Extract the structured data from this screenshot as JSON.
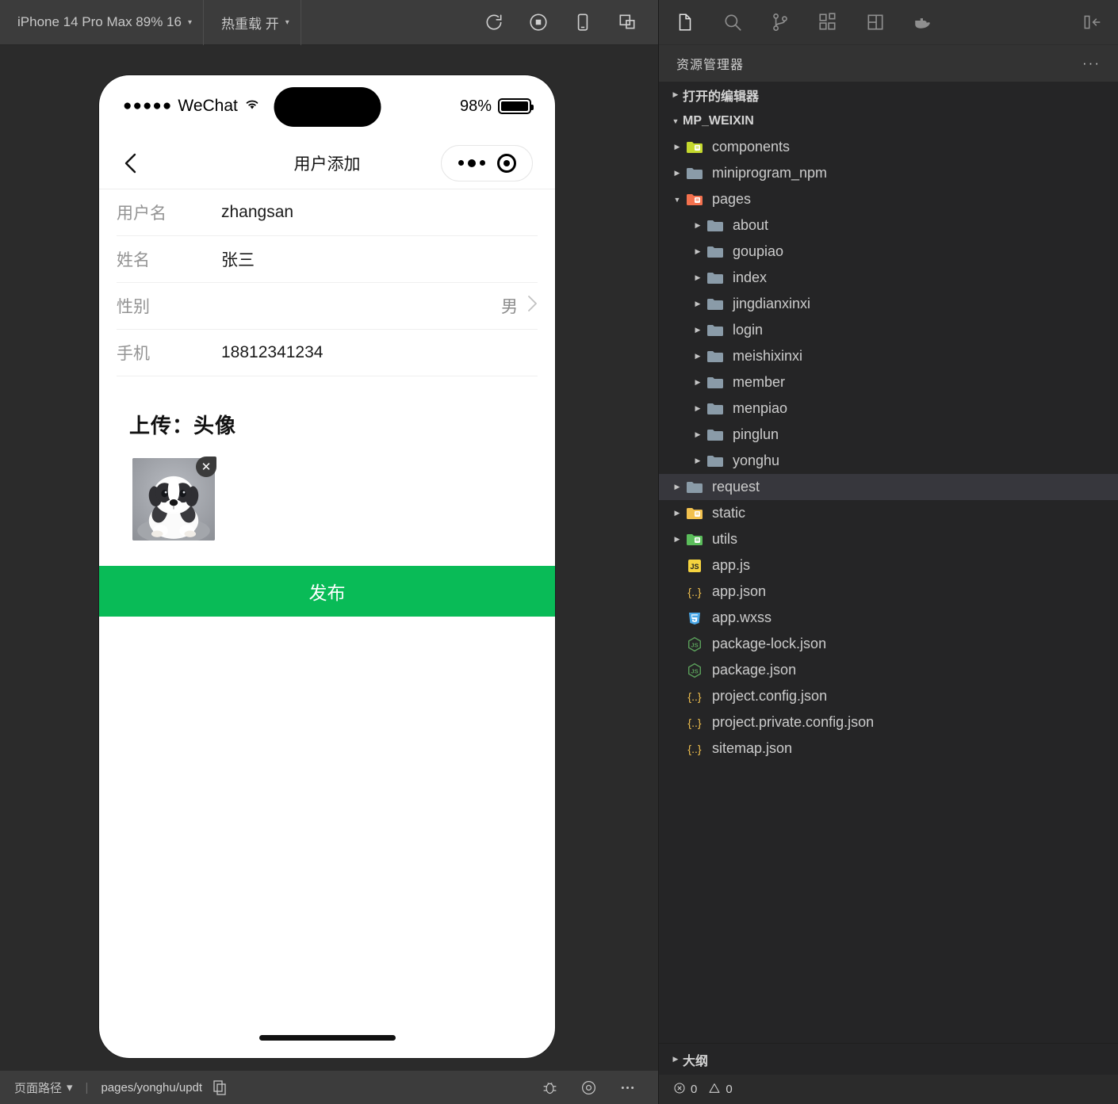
{
  "simulator": {
    "toolbar": {
      "device_label": "iPhone 14 Pro Max 89% 16",
      "hotreload_label": "热重载 开",
      "caret": "▾",
      "icons": [
        "refresh-icon",
        "stop-record-icon",
        "phone-icon",
        "multi-window-icon"
      ]
    },
    "phone": {
      "status_bar": {
        "signal_dots": "●●●●●",
        "carrier": "WeChat",
        "wifi": "wifi-icon",
        "battery_percent": "98%"
      },
      "nav": {
        "back": "back-chevron-icon",
        "title": "用户添加",
        "capsule_more": "more-dots-icon",
        "capsule_target": "target-icon"
      },
      "form": [
        {
          "label": "用户名",
          "value": "zhangsan",
          "type": "text"
        },
        {
          "label": "姓名",
          "value": "张三",
          "type": "text"
        },
        {
          "label": "性别",
          "value": "男",
          "type": "picker"
        },
        {
          "label": "手机",
          "value": "18812341234",
          "type": "text"
        }
      ],
      "upload": {
        "title": "上传：头像",
        "delete_glyph": "✕",
        "image_alt": "puppy-avatar"
      },
      "publish_label": "发布"
    },
    "bottom_bar": {
      "selector_label": "页面路径",
      "caret": "▾",
      "separator": "|",
      "path": "pages/yonghu/updt",
      "copy_icon": "copy-icon",
      "right_icons": [
        "bug-icon",
        "eye-icon",
        "more-icon"
      ]
    }
  },
  "vscode": {
    "activity_icons": [
      "explorer-icon",
      "search-icon",
      "source-control-icon",
      "extensions-icon",
      "split-layout-icon",
      "docker-icon"
    ],
    "collapse_icon": "collapse-sidebar-icon",
    "panel_title": "资源管理器",
    "panel_more": "···",
    "sections": {
      "open_editors": "打开的编辑器",
      "workspace": "MP_WEIXIN",
      "outline": "大纲"
    },
    "tree": [
      {
        "name": "components",
        "kind": "folder",
        "icon": "folder-components",
        "depth": 1,
        "arrow": "▸",
        "selected": false
      },
      {
        "name": "miniprogram_npm",
        "kind": "folder",
        "icon": "folder-plain",
        "depth": 1,
        "arrow": "▸",
        "selected": false
      },
      {
        "name": "pages",
        "kind": "folder",
        "icon": "folder-pages",
        "depth": 1,
        "arrow": "▾",
        "selected": false
      },
      {
        "name": "about",
        "kind": "folder",
        "icon": "folder-plain",
        "depth": 2,
        "arrow": "▸",
        "selected": false
      },
      {
        "name": "goupiao",
        "kind": "folder",
        "icon": "folder-plain",
        "depth": 2,
        "arrow": "▸",
        "selected": false
      },
      {
        "name": "index",
        "kind": "folder",
        "icon": "folder-plain",
        "depth": 2,
        "arrow": "▸",
        "selected": false
      },
      {
        "name": "jingdianxinxi",
        "kind": "folder",
        "icon": "folder-plain",
        "depth": 2,
        "arrow": "▸",
        "selected": false
      },
      {
        "name": "login",
        "kind": "folder",
        "icon": "folder-plain",
        "depth": 2,
        "arrow": "▸",
        "selected": false
      },
      {
        "name": "meishixinxi",
        "kind": "folder",
        "icon": "folder-plain",
        "depth": 2,
        "arrow": "▸",
        "selected": false
      },
      {
        "name": "member",
        "kind": "folder",
        "icon": "folder-plain",
        "depth": 2,
        "arrow": "▸",
        "selected": false
      },
      {
        "name": "menpiao",
        "kind": "folder",
        "icon": "folder-plain",
        "depth": 2,
        "arrow": "▸",
        "selected": false
      },
      {
        "name": "pinglun",
        "kind": "folder",
        "icon": "folder-plain",
        "depth": 2,
        "arrow": "▸",
        "selected": false
      },
      {
        "name": "yonghu",
        "kind": "folder",
        "icon": "folder-plain",
        "depth": 2,
        "arrow": "▸",
        "selected": false
      },
      {
        "name": "request",
        "kind": "folder",
        "icon": "folder-plain",
        "depth": 1,
        "arrow": "▸",
        "selected": true
      },
      {
        "name": "static",
        "kind": "folder",
        "icon": "folder-static",
        "depth": 1,
        "arrow": "▸",
        "selected": false
      },
      {
        "name": "utils",
        "kind": "folder",
        "icon": "folder-utils",
        "depth": 1,
        "arrow": "▸",
        "selected": false
      },
      {
        "name": "app.js",
        "kind": "file",
        "icon": "js-file",
        "depth": 1,
        "arrow": "",
        "selected": false
      },
      {
        "name": "app.json",
        "kind": "file",
        "icon": "json-file",
        "depth": 1,
        "arrow": "",
        "selected": false
      },
      {
        "name": "app.wxss",
        "kind": "file",
        "icon": "css-file",
        "depth": 1,
        "arrow": "",
        "selected": false
      },
      {
        "name": "package-lock.json",
        "kind": "file",
        "icon": "npm-file",
        "depth": 1,
        "arrow": "",
        "selected": false
      },
      {
        "name": "package.json",
        "kind": "file",
        "icon": "npm-file",
        "depth": 1,
        "arrow": "",
        "selected": false
      },
      {
        "name": "project.config.json",
        "kind": "file",
        "icon": "json-file",
        "depth": 1,
        "arrow": "",
        "selected": false
      },
      {
        "name": "project.private.config.json",
        "kind": "file",
        "icon": "json-file",
        "depth": 1,
        "arrow": "",
        "selected": false
      },
      {
        "name": "sitemap.json",
        "kind": "file",
        "icon": "json-file",
        "depth": 1,
        "arrow": "",
        "selected": false
      }
    ],
    "status_bar": {
      "error_icon": "error-circle-icon",
      "error_count": "0",
      "warning_icon": "warning-triangle-icon",
      "warning_count": "0"
    }
  },
  "colors": {
    "wechat_green": "#09bb57",
    "devtools_bg": "#2b2b2b",
    "toolbar_bg": "#3c3c3c",
    "vscode_sidebar": "#252526",
    "vscode_activity": "#333333",
    "selection": "#37373d"
  }
}
